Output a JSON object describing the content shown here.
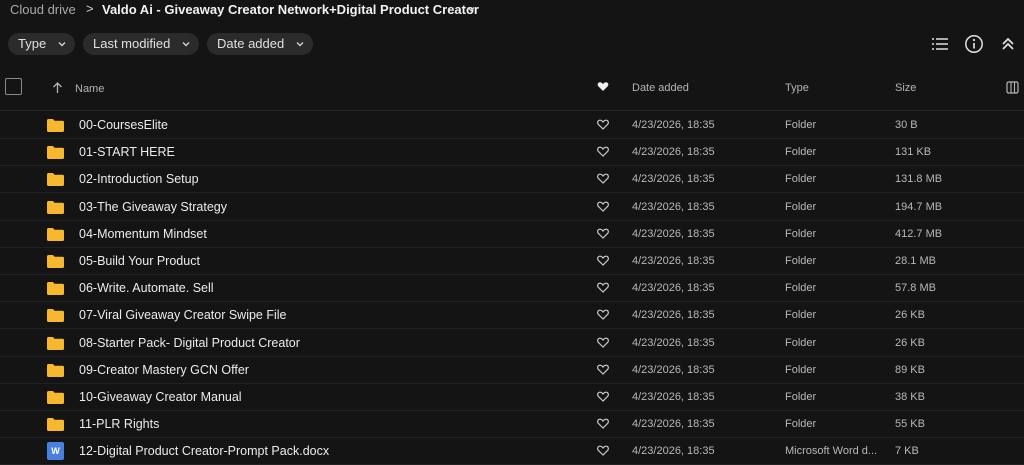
{
  "breadcrumb": {
    "root": "Cloud drive",
    "separator": ">",
    "current": "Valdo Ai - Giveaway Creator Network+Digital Product Creator"
  },
  "filters": {
    "type": "Type",
    "last_modified": "Last modified",
    "date_added": "Date added"
  },
  "toolbar": {
    "icons": [
      "list-view-icon",
      "info-icon",
      "collapse-icon"
    ]
  },
  "columns": {
    "name": "Name",
    "date_added": "Date added",
    "type": "Type",
    "size": "Size"
  },
  "colors": {
    "background": "#141414",
    "folder": "#f5b82e",
    "word": "#4a7fe0"
  },
  "files": [
    {
      "name": "00-CoursesElite",
      "date": "4/23/2026, 18:35",
      "type": "Folder",
      "size": "30 B",
      "icon": "folder"
    },
    {
      "name": "01-START HERE",
      "date": "4/23/2026, 18:35",
      "type": "Folder",
      "size": "131 KB",
      "icon": "folder"
    },
    {
      "name": "02-Introduction Setup",
      "date": "4/23/2026, 18:35",
      "type": "Folder",
      "size": "131.8 MB",
      "icon": "folder"
    },
    {
      "name": "03-The Giveaway Strategy",
      "date": "4/23/2026, 18:35",
      "type": "Folder",
      "size": "194.7 MB",
      "icon": "folder"
    },
    {
      "name": "04-Momentum Mindset",
      "date": "4/23/2026, 18:35",
      "type": "Folder",
      "size": "412.7 MB",
      "icon": "folder"
    },
    {
      "name": "05-Build Your Product",
      "date": "4/23/2026, 18:35",
      "type": "Folder",
      "size": "28.1 MB",
      "icon": "folder"
    },
    {
      "name": "06-Write. Automate. Sell",
      "date": "4/23/2026, 18:35",
      "type": "Folder",
      "size": "57.8 MB",
      "icon": "folder"
    },
    {
      "name": "07-Viral Giveaway Creator Swipe File",
      "date": "4/23/2026, 18:35",
      "type": "Folder",
      "size": "26 KB",
      "icon": "folder"
    },
    {
      "name": "08-Starter Pack- Digital Product Creator",
      "date": "4/23/2026, 18:35",
      "type": "Folder",
      "size": "26 KB",
      "icon": "folder"
    },
    {
      "name": "09-Creator Mastery GCN Offer",
      "date": "4/23/2026, 18:35",
      "type": "Folder",
      "size": "89 KB",
      "icon": "folder"
    },
    {
      "name": "10-Giveaway Creator Manual",
      "date": "4/23/2026, 18:35",
      "type": "Folder",
      "size": "38 KB",
      "icon": "folder"
    },
    {
      "name": "11-PLR Rights",
      "date": "4/23/2026, 18:35",
      "type": "Folder",
      "size": "55 KB",
      "icon": "folder"
    },
    {
      "name": "12-Digital Product Creator-Prompt Pack.docx",
      "date": "4/23/2026, 18:35",
      "type": "Microsoft Word d...",
      "size": "7 KB",
      "icon": "word",
      "icon_letter": "W"
    }
  ]
}
